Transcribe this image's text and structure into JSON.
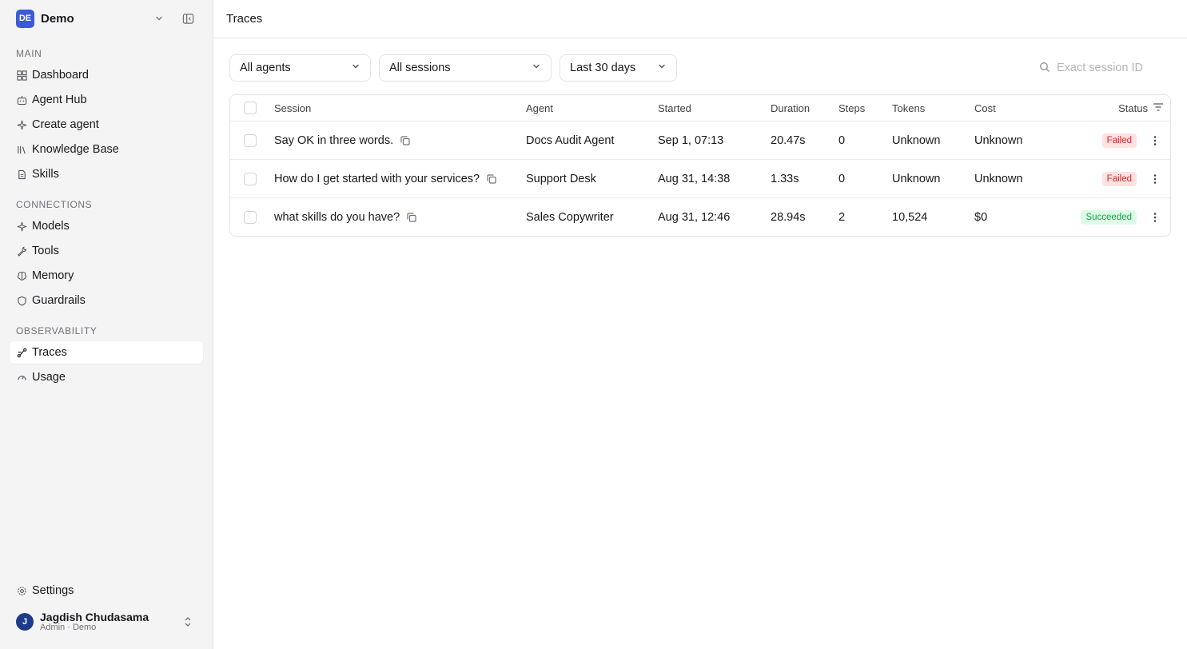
{
  "workspace": {
    "badge": "DE",
    "name": "Demo"
  },
  "sidebar": {
    "sections": [
      {
        "label": "MAIN",
        "items": [
          {
            "label": "Dashboard",
            "icon": "dashboard-icon"
          },
          {
            "label": "Agent Hub",
            "icon": "agent-hub-icon"
          },
          {
            "label": "Create agent",
            "icon": "sparkle-icon"
          },
          {
            "label": "Knowledge Base",
            "icon": "library-icon"
          },
          {
            "label": "Skills",
            "icon": "document-icon"
          }
        ]
      },
      {
        "label": "CONNECTIONS",
        "items": [
          {
            "label": "Models",
            "icon": "sparkle-icon"
          },
          {
            "label": "Tools",
            "icon": "wrench-icon"
          },
          {
            "label": "Memory",
            "icon": "brain-icon"
          },
          {
            "label": "Guardrails",
            "icon": "shield-icon"
          }
        ]
      },
      {
        "label": "OBSERVABILITY",
        "items": [
          {
            "label": "Traces",
            "icon": "traces-icon",
            "active": true
          },
          {
            "label": "Usage",
            "icon": "gauge-icon"
          }
        ]
      }
    ],
    "settings": {
      "label": "Settings",
      "icon": "gear-icon"
    }
  },
  "user": {
    "initial": "J",
    "name": "Jagdish Chudasama",
    "role": "Admin · Demo"
  },
  "header": {
    "title": "Traces"
  },
  "filters": {
    "agents": "All agents",
    "sessions": "All sessions",
    "range": "Last 30 days",
    "search_placeholder": "Exact session ID"
  },
  "table": {
    "columns": {
      "session": "Session",
      "agent": "Agent",
      "started": "Started",
      "duration": "Duration",
      "steps": "Steps",
      "tokens": "Tokens",
      "cost": "Cost",
      "status": "Status"
    },
    "rows": [
      {
        "session": "Say OK in three words.",
        "agent": "Docs Audit Agent",
        "started": "Sep 1, 07:13",
        "duration": "20.47s",
        "steps": "0",
        "tokens": "Unknown",
        "cost": "Unknown",
        "status": "Failed"
      },
      {
        "session": "How do I get started with your services?",
        "agent": "Support Desk",
        "started": "Aug 31, 14:38",
        "duration": "1.33s",
        "steps": "0",
        "tokens": "Unknown",
        "cost": "Unknown",
        "status": "Failed"
      },
      {
        "session": "what skills do you have?",
        "agent": "Sales Copywriter",
        "started": "Aug 31, 12:46",
        "duration": "28.94s",
        "steps": "2",
        "tokens": "10,524",
        "cost": "$0",
        "status": "Succeeded"
      }
    ]
  },
  "colors": {
    "accent": "#3b5bdb",
    "failed": "#dc2626",
    "succeeded": "#16a34a"
  }
}
